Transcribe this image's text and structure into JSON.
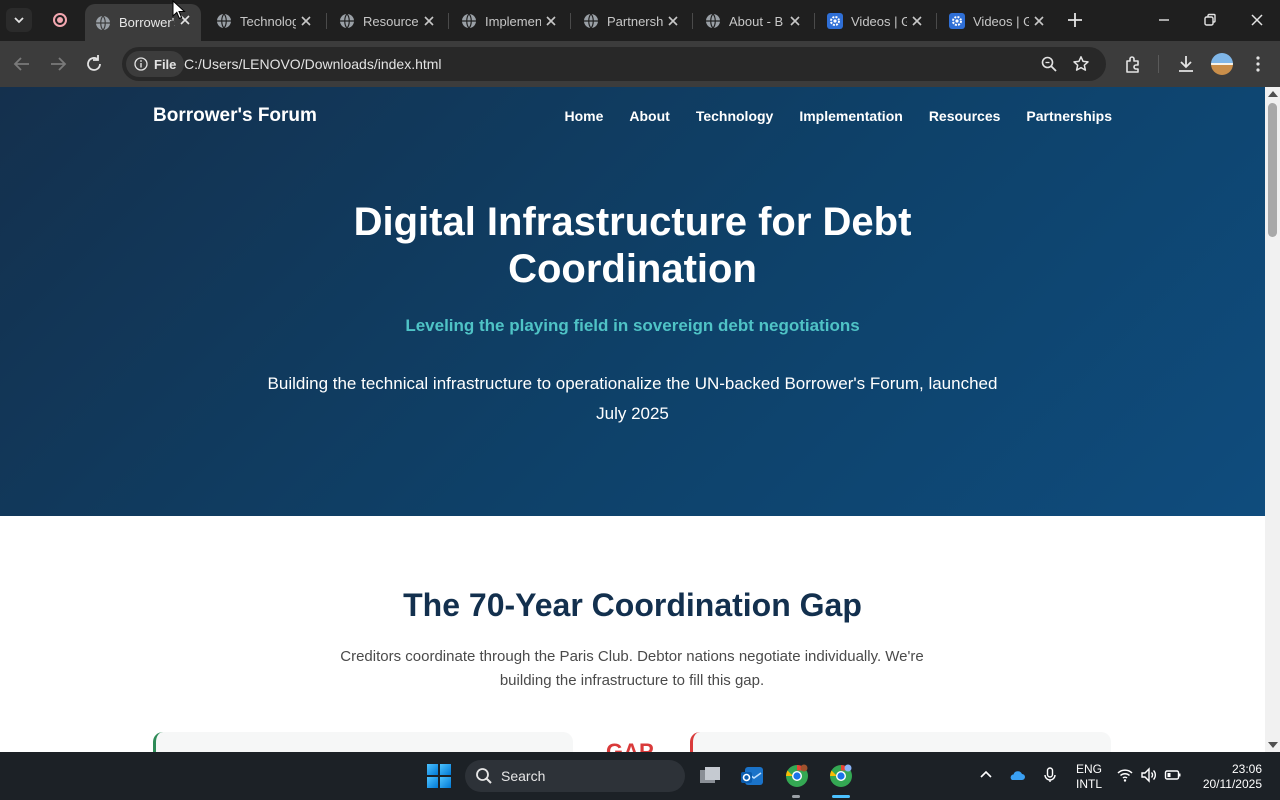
{
  "browser": {
    "tabs": [
      {
        "title": "Borrower's Forum",
        "active": true,
        "icon": "globe-icon"
      },
      {
        "title": "Technology",
        "active": false,
        "icon": "globe-icon"
      },
      {
        "title": "Resources",
        "active": false,
        "icon": "globe-icon"
      },
      {
        "title": "Implementation",
        "active": false,
        "icon": "globe-icon"
      },
      {
        "title": "Partnerships",
        "active": false,
        "icon": "globe-icon"
      },
      {
        "title": "About - B",
        "active": false,
        "icon": "globe-icon"
      },
      {
        "title": "Videos | G",
        "active": false,
        "icon": "gear-badge-icon"
      },
      {
        "title": "Videos | G",
        "active": false,
        "icon": "gear-badge-icon"
      }
    ],
    "site_chip": "File",
    "url": "C:/Users/LENOVO/Downloads/index.html"
  },
  "page": {
    "brand": "Borrower's Forum",
    "nav": [
      "Home",
      "About",
      "Technology",
      "Implementation",
      "Resources",
      "Partnerships"
    ],
    "hero": {
      "title_line1": "Digital Infrastructure for Debt",
      "title_line2": "Coordination",
      "tagline": "Leveling the playing field in sovereign debt negotiations",
      "description": "Building the technical infrastructure to operationalize the UN-backed Borrower's Forum, launched July 2025"
    },
    "section": {
      "title": "The 70-Year Coordination Gap",
      "description": "Creditors coordinate through the Paris Club. Debtor nations negotiate individually. We're building the infrastructure to fill this gap.",
      "gap_label": "GAP"
    }
  },
  "taskbar": {
    "search_label": "Search",
    "lang_line1": "ENG",
    "lang_line2": "INTL",
    "time": "23:06",
    "date": "20/11/2025"
  },
  "colors": {
    "hero_bg": "#0e4169",
    "tagline": "#4fc3c6",
    "section_title": "#13304e",
    "gap_red": "#d93a3a",
    "card_green": "#2e8b57"
  }
}
